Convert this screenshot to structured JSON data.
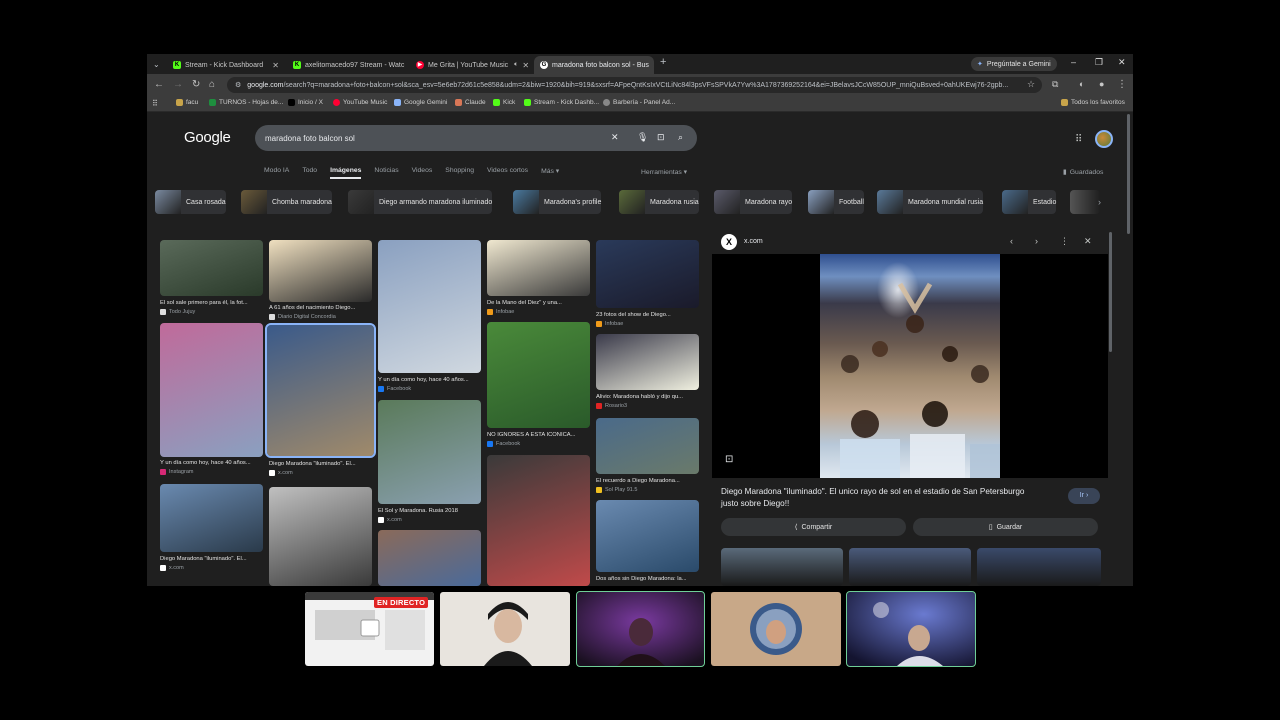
{
  "tabs": [
    {
      "label": "Stream - Kick Dashboard",
      "color": "#53fc18",
      "glyph": "K"
    },
    {
      "label": "axelitomacedo97 Stream - Watc",
      "color": "#53fc18",
      "glyph": "K"
    },
    {
      "label": "Me Grita | YouTube Music",
      "color": "#ff0033",
      "glyph": "▶"
    },
    {
      "label": "maradona foto balcon sol - Bus",
      "color": "#ffffff",
      "glyph": "G"
    }
  ],
  "gemini_label": "Pregúntale a Gemini",
  "url": {
    "host": "google.com",
    "path": "/search?q=maradona+foto+balcon+sol&sca_esv=5e6eb72d61c5e858&udm=2&biw=1920&bih=919&sxsrf=AFpeQntKsIxVCtLiNc84l3psVFsSPVkA7Yw%3A1787369252164&ei=JBelavsJCcW85OUP_mniQuBsved+0ahUKEwj76-2gpb..."
  },
  "bookmarks": [
    {
      "label": "facu",
      "color": "#c8a44a"
    },
    {
      "label": "TURNOS - Hojas de...",
      "color": "#1e8e3e"
    },
    {
      "label": "Inicio / X",
      "color": "#000000"
    },
    {
      "label": "YouTube Music",
      "color": "#ff0033"
    },
    {
      "label": "Google Gemini",
      "color": "#8ab4f8"
    },
    {
      "label": "Claude",
      "color": "#d97757"
    },
    {
      "label": "Kick",
      "color": "#53fc18"
    },
    {
      "label": "Stream - Kick Dashb...",
      "color": "#53fc18"
    },
    {
      "label": "Barbería - Panel Ad...",
      "color": "#888888"
    }
  ],
  "bookmarks_all": "Todos los favoritos",
  "google": {
    "logo": "Google",
    "query": "maradona foto balcon sol",
    "nav_tabs": [
      "Modo IA",
      "Todo",
      "Imágenes",
      "Noticias",
      "Videos",
      "Shopping",
      "Videos cortos",
      "Más ▾"
    ],
    "active_tab": 2,
    "tools": "Herramientas ▾",
    "saved": "Guardados"
  },
  "chips": [
    {
      "label": "Casa rosada",
      "color": "#7a8aa0"
    },
    {
      "label": "Chomba maradona",
      "color": "#6a5a3a"
    },
    {
      "label": "Diego armando maradona iluminado",
      "color": "#3a3a3a"
    },
    {
      "label": "Maradona's profile",
      "color": "#4a7aa0"
    },
    {
      "label": "Maradona rusia",
      "color": "#5a6a3a"
    },
    {
      "label": "Maradona rayo",
      "color": "#5a5a6a"
    },
    {
      "label": "Football",
      "color": "#8aa0c0"
    },
    {
      "label": "Maradona mundial rusia",
      "color": "#5a7a9a"
    },
    {
      "label": "Estadio",
      "color": "#4a6a8a"
    }
  ],
  "results": [
    {
      "caption": "El sol sale primero para él, la fot...",
      "source": "Todo Jujuy",
      "src_color": "#dddddd",
      "color": "#5a6a5a",
      "color2": "#2a3a2a"
    },
    {
      "caption": "A 61 años del nacimiento Diego...",
      "source": "Diario Digital Concordia",
      "src_color": "#dddddd",
      "color": "#f0e0c0",
      "color2": "#2a2a2a"
    },
    {
      "caption": "Y un día como hoy, hace 40 años...",
      "source": "Facebook",
      "src_color": "#1877f2",
      "color": "#8aa0c0",
      "color2": "#d0d8e0"
    },
    {
      "caption": "De la Mano del Diez\" y una...",
      "source": "Infobae",
      "src_color": "#f09b1a",
      "color": "#f0e8d0",
      "color2": "#3a3a3a"
    },
    {
      "caption": "23 fotos del show de Diego...",
      "source": "Infobae",
      "src_color": "#f09b1a",
      "color": "#2a3a5a",
      "color2": "#1a1a2a"
    },
    {
      "caption": "Y un día como hoy, hace 40 años...",
      "source": "Instagram",
      "src_color": "#d62976",
      "color": "#c06a9a",
      "color2": "#8aa0c0"
    },
    {
      "caption": "Diego Maradona \"iluminado\". El...",
      "source": "x.com",
      "src_color": "#ffffff",
      "color": "#3a5a8a",
      "color2": "#a08a6a"
    },
    {
      "caption": "NO IGNORES A ESTA ICONICA...",
      "source": "Facebook",
      "src_color": "#1877f2",
      "color": "#4a8a3a",
      "color2": "#2a5a2a"
    },
    {
      "caption": "Alivio: Maradona habló y dijo qu...",
      "source": "Rosario3",
      "src_color": "#e02424",
      "color": "#3a3a4a",
      "color2": "#f0f0e0"
    },
    {
      "caption": "El Sol y Maradona. Rusia 2018",
      "source": "x.com",
      "src_color": "#ffffff",
      "color": "#5a7a5a",
      "color2": "#8aa0b0"
    },
    {
      "caption": "El recuerdo a Diego Maradona...",
      "source": "Sol Play 91.5",
      "src_color": "#f0c020",
      "color": "#4a6a8a",
      "color2": "#6a7a6a"
    },
    {
      "caption": "Diego Maradona \"iluminado\". El...",
      "source": "x.com",
      "src_color": "#ffffff",
      "color": "#6a8ab0",
      "color2": "#2a3a4a"
    },
    {
      "caption": "",
      "source": "",
      "src_color": "#ffffff",
      "color": "#c0c0c0",
      "color2": "#3a3a3a"
    },
    {
      "caption": "",
      "source": "",
      "src_color": "#ffffff",
      "color": "#8a6a5a",
      "color2": "#4a6a9a"
    },
    {
      "caption": "",
      "source": "",
      "src_color": "#ffffff",
      "color": "#3a3a3a",
      "color2": "#c04a4a"
    },
    {
      "caption": "Dos años sin Diego Maradona: la...",
      "source": "",
      "src_color": "#ffffff",
      "color": "#6a8ab0",
      "color2": "#2a4a6a"
    }
  ],
  "preview": {
    "domain": "x.com",
    "title": "Diego Maradona \"iluminado\". El unico rayo de sol en el estadio de San Petersburgo justo sobre Diego!!",
    "go_label": "Ir ›",
    "share_label": "Compartir",
    "save_label": "Guardar",
    "related": [
      {
        "color": "#5a6a7a"
      },
      {
        "color": "#4a5a7a"
      },
      {
        "color": "#3a4a6a"
      }
    ]
  },
  "stream": {
    "live_badge": "EN DIRECTO",
    "cams": [
      {
        "name": "screen-share",
        "color": "#c8c8c8",
        "color2": "#6a6a6a"
      },
      {
        "name": "cam-host",
        "color": "#e8e0d8",
        "color2": "#1a1a1a"
      },
      {
        "name": "cam-guest-1",
        "color": "#6a3a8a",
        "color2": "#1a1020"
      },
      {
        "name": "cam-guest-2",
        "color": "#c0a080",
        "color2": "#4a7aa0"
      },
      {
        "name": "cam-guest-3",
        "color": "#3a4a9a",
        "color2": "#1a1a3a"
      }
    ]
  }
}
